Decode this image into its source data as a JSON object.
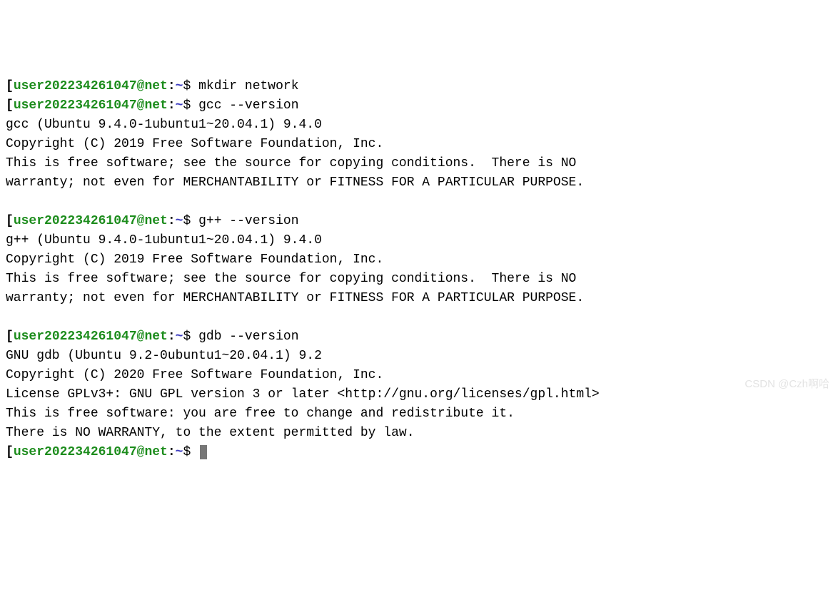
{
  "prompt": {
    "bracket_open": "[",
    "user": "user202234261047",
    "at": "@",
    "host": "net",
    "colon": ":",
    "path": "~",
    "dollar": "$ "
  },
  "blocks": [
    {
      "cmd": "mkdir network",
      "out": []
    },
    {
      "cmd": "gcc --version",
      "out": [
        "gcc (Ubuntu 9.4.0-1ubuntu1~20.04.1) 9.4.0",
        "Copyright (C) 2019 Free Software Foundation, Inc.",
        "This is free software; see the source for copying conditions.  There is NO",
        "warranty; not even for MERCHANTABILITY or FITNESS FOR A PARTICULAR PURPOSE.",
        ""
      ]
    },
    {
      "cmd": "g++ --version",
      "out": [
        "g++ (Ubuntu 9.4.0-1ubuntu1~20.04.1) 9.4.0",
        "Copyright (C) 2019 Free Software Foundation, Inc.",
        "This is free software; see the source for copying conditions.  There is NO",
        "warranty; not even for MERCHANTABILITY or FITNESS FOR A PARTICULAR PURPOSE.",
        ""
      ]
    },
    {
      "cmd": "gdb --version",
      "out": [
        "GNU gdb (Ubuntu 9.2-0ubuntu1~20.04.1) 9.2",
        "Copyright (C) 2020 Free Software Foundation, Inc.",
        "License GPLv3+: GNU GPL version 3 or later <http://gnu.org/licenses/gpl.html>",
        "This is free software: you are free to change and redistribute it.",
        "There is NO WARRANTY, to the extent permitted by law."
      ]
    }
  ],
  "final_prompt_cmd": "",
  "watermark": "CSDN @Czh啊哈"
}
